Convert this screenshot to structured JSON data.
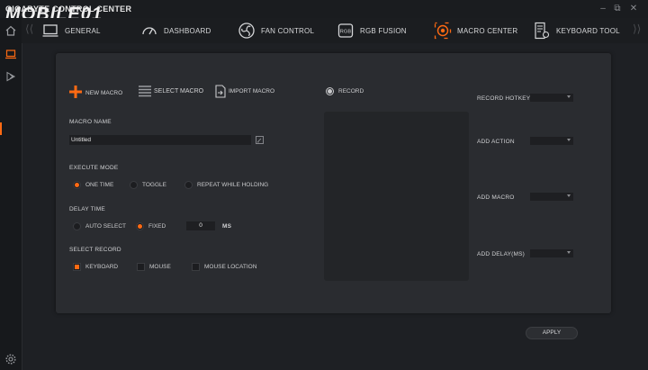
{
  "app": {
    "title": "GIGABYTE CONTROL CENTER",
    "watermark": "MOBILE01"
  },
  "window_controls": {
    "minimize": "–",
    "restore": "⧉",
    "close": "✕"
  },
  "nav": {
    "items": [
      {
        "label": "GENERAL",
        "icon": "monitor-icon"
      },
      {
        "label": "DASHBOARD",
        "icon": "gauge-icon"
      },
      {
        "label": "FAN CONTROL",
        "icon": "fan-icon"
      },
      {
        "label": "RGB FUSION",
        "icon": "rgb-icon"
      },
      {
        "label": "MACRO CENTER",
        "icon": "target-icon",
        "active": true
      },
      {
        "label": "KEYBOARD TOOL",
        "icon": "keyboard-gear-icon"
      }
    ]
  },
  "toolbar": {
    "new_macro": "NEW MACRO",
    "select_macro": "SELECT MACRO",
    "import_macro": "IMPORT MACRO",
    "record": "RECORD"
  },
  "macro_name": {
    "label": "MACRO NAME",
    "value": "Untitled"
  },
  "execute_mode": {
    "label": "EXECUTE MODE",
    "options": [
      "ONE TIME",
      "TOGGLE",
      "REPEAT WHILE HOLDING"
    ],
    "selected": "ONE TIME"
  },
  "delay_time": {
    "label": "DELAY TIME",
    "options": [
      "AUTO SELECT",
      "FIXED"
    ],
    "selected": "FIXED",
    "value": "0",
    "unit": "MS"
  },
  "select_record": {
    "label": "SELECT RECORD",
    "options": [
      "KEYBOARD",
      "MOUSE",
      "MOUSE LOCATION"
    ],
    "checked": [
      "KEYBOARD"
    ]
  },
  "right_panel": {
    "record_hotkey": "RECORD HOTKEY",
    "add_action": "ADD ACTION",
    "add_macro": "ADD MACRO",
    "add_delay": "ADD DELAY(MS)"
  },
  "apply_label": "APPLY",
  "colors": {
    "accent": "#ff6a13",
    "background": "#1e2024",
    "panel": "#2a2c30"
  }
}
